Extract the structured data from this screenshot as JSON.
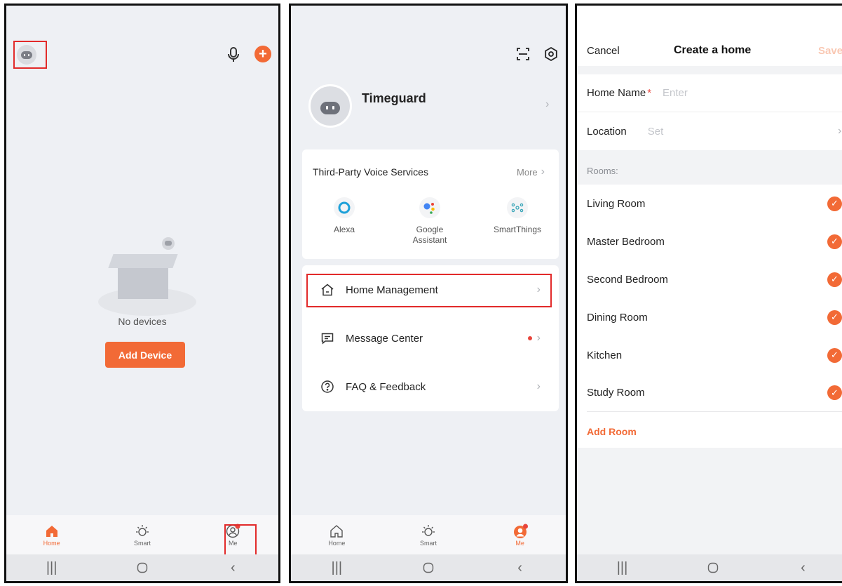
{
  "screen1": {
    "empty_text": "No devices",
    "add_device_label": "Add Device",
    "tabs": [
      {
        "label": "Home",
        "icon": "home-icon",
        "active": true
      },
      {
        "label": "Smart",
        "icon": "sun-icon",
        "active": false
      },
      {
        "label": "Me",
        "icon": "profile-icon",
        "active": false
      }
    ]
  },
  "screen2": {
    "user_name": "Timeguard",
    "voice": {
      "title": "Third-Party Voice Services",
      "more_label": "More",
      "services": [
        {
          "label": "Alexa",
          "icon": "alexa-icon"
        },
        {
          "label": "Google\nAssistant",
          "icon": "google-assistant-icon"
        },
        {
          "label": "SmartThings",
          "icon": "smartthings-icon"
        }
      ]
    },
    "menu": [
      {
        "label": "Home Management",
        "icon": "house-icon"
      },
      {
        "label": "Message Center",
        "icon": "message-icon"
      },
      {
        "label": "FAQ & Feedback",
        "icon": "question-icon"
      }
    ],
    "tabs": [
      {
        "label": "Home",
        "icon": "home-icon",
        "active": false
      },
      {
        "label": "Smart",
        "icon": "sun-icon",
        "active": false
      },
      {
        "label": "Me",
        "icon": "profile-icon",
        "active": true
      }
    ]
  },
  "screen3": {
    "cancel_label": "Cancel",
    "title": "Create a home",
    "save_label": "Save",
    "home_name_label": "Home Name",
    "required_mark": "*",
    "home_name_placeholder": "Enter",
    "location_label": "Location",
    "location_value": "Set",
    "rooms_header": "Rooms:",
    "rooms": [
      "Living Room",
      "Master Bedroom",
      "Second Bedroom",
      "Dining Room",
      "Kitchen",
      "Study Room"
    ],
    "add_room_label": "Add Room"
  },
  "colors": {
    "accent": "#f26a36",
    "highlight_box": "#e22a2a",
    "background": "#eef0f4"
  }
}
